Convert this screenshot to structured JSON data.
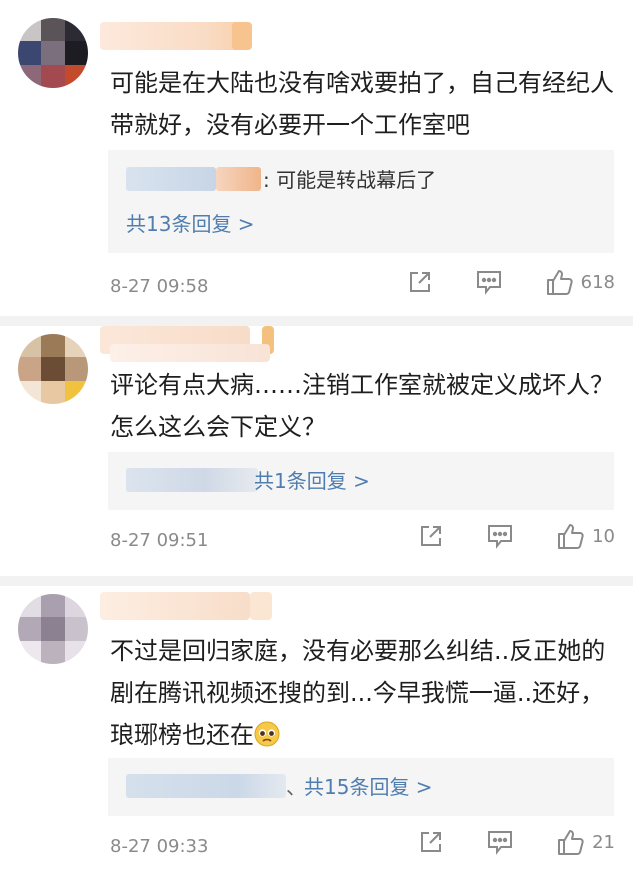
{
  "comments": [
    {
      "text": "可能是在大陆也没有啥戏要拍了，自己有经纪人带就好，没有必要开一个工作室吧",
      "reply_preview": ": 可能是转战幕后了",
      "reply_link": "共13条回复 >",
      "time": "8-27 09:58",
      "likes": "618"
    },
    {
      "text": "评论有点大病……注销工作室就被定义成坏人？怎么这么会下定义？",
      "reply_preview": "",
      "reply_link": "共1条回复 >",
      "time": "8-27 09:51",
      "likes": "10"
    },
    {
      "text": "不过是回归家庭，没有必要那么纠结..反正她的剧在腾讯视频还搜的到...今早我慌一逼..还好，琅琊榜也还在",
      "reply_preview": "、",
      "reply_link": "共15条回复 >",
      "time": "8-27 09:33",
      "likes": "21"
    }
  ],
  "icons": {
    "share": "share-icon",
    "comment": "comment-icon",
    "like": "thumbs-up-icon",
    "emoji": "pleading-face-emoji"
  },
  "colors": {
    "link": "#507daf",
    "meta": "#8a8a8a",
    "reply_bg": "#f5f5f5"
  }
}
